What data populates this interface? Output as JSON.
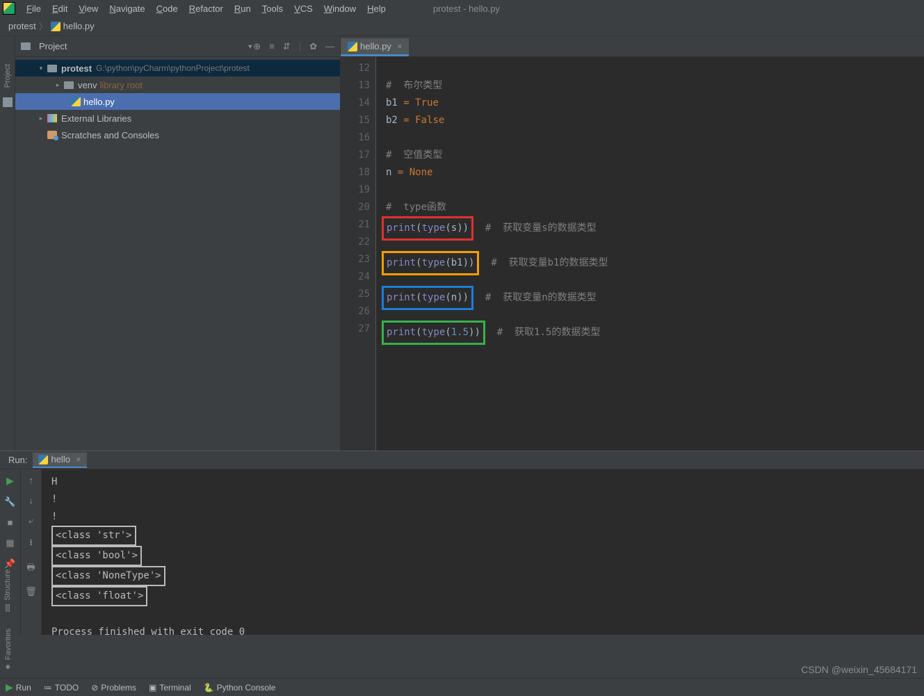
{
  "window_title": "protest - hello.py",
  "menu": [
    "File",
    "Edit",
    "View",
    "Navigate",
    "Code",
    "Refactor",
    "Run",
    "Tools",
    "VCS",
    "Window",
    "Help"
  ],
  "breadcrumb": {
    "project": "protest",
    "file": "hello.py"
  },
  "project_panel": {
    "title": "Project",
    "root": {
      "name": "protest",
      "path": "G:\\python\\pyCharm\\pythonProject\\protest"
    },
    "venv": {
      "name": "venv",
      "tag": "library root"
    },
    "file": "hello.py",
    "external": "External Libraries",
    "scratches": "Scratches and Consoles"
  },
  "editor": {
    "tab": "hello.py",
    "lines": [
      {
        "n": 12,
        "t": ""
      },
      {
        "n": 13,
        "t": "comment",
        "v": "#  布尔类型"
      },
      {
        "n": 14,
        "t": "assign",
        "lhs": "b1",
        "rhs": "True"
      },
      {
        "n": 15,
        "t": "assign",
        "lhs": "b2",
        "rhs": "False"
      },
      {
        "n": 16,
        "t": ""
      },
      {
        "n": 17,
        "t": "comment",
        "v": "#  空值类型"
      },
      {
        "n": 18,
        "t": "assign",
        "lhs": "n",
        "rhs": "None"
      },
      {
        "n": 19,
        "t": ""
      },
      {
        "n": 20,
        "t": "comment",
        "v": "#  type函数"
      },
      {
        "n": 21,
        "t": "print",
        "arg": "s",
        "box": "red",
        "c": "#  获取变量s的数据类型"
      },
      {
        "n": 22,
        "t": ""
      },
      {
        "n": 23,
        "t": "print",
        "arg": "b1",
        "box": "orange",
        "c": "#  获取变量b1的数据类型"
      },
      {
        "n": 24,
        "t": ""
      },
      {
        "n": 25,
        "t": "print",
        "arg": "n",
        "box": "blue",
        "c": "#  获取变量n的数据类型"
      },
      {
        "n": 26,
        "t": ""
      },
      {
        "n": 27,
        "t": "printnum",
        "arg": "1.5",
        "box": "green",
        "c": "#  获取1.5的数据类型"
      }
    ]
  },
  "run": {
    "label": "Run:",
    "tab": "hello",
    "out_plain": [
      "H",
      "!",
      "!"
    ],
    "out_boxed": [
      {
        "v": "<class 'str'>",
        "box": "red"
      },
      {
        "v": "<class 'bool'>",
        "box": "orange"
      },
      {
        "v": "<class 'NoneType'>",
        "box": "blue"
      },
      {
        "v": "<class 'float'>",
        "box": "green"
      }
    ],
    "exit": "Process finished with exit code 0"
  },
  "status": [
    "Run",
    "TODO",
    "Problems",
    "Terminal",
    "Python Console"
  ],
  "watermark": "CSDN @weixin_45684171",
  "side": {
    "project": "Project",
    "structure": "Structure",
    "favorites": "Favorites"
  }
}
